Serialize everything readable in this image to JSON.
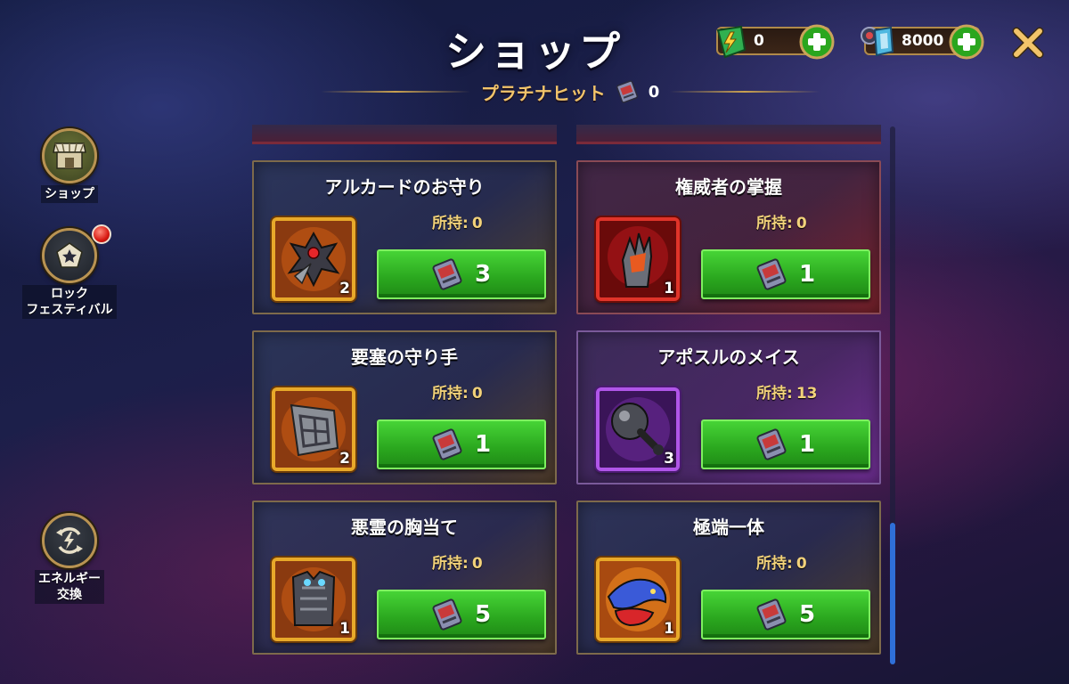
{
  "header": {
    "title": "ショップ",
    "subtitle": "プラチナヒット",
    "ticket_count": "0"
  },
  "currencies": {
    "energy": {
      "value": "0",
      "icon": "energy-gem-icon"
    },
    "gems": {
      "value": "8000",
      "icon": "crystal-gem-icon"
    }
  },
  "sidebar": {
    "items": [
      {
        "label": "ショップ",
        "icon": "shop-icon",
        "active": true
      },
      {
        "label": "ロック\nフェスティバル",
        "label_line1": "ロック",
        "label_line2": "フェスティバル",
        "icon": "star-pentagon-icon",
        "has_badge": true
      },
      {
        "label": "エネルギー\n交換",
        "label_line1": "エネルギー",
        "label_line2": "交換",
        "icon": "energy-exchange-icon"
      }
    ]
  },
  "owned_label": "所持:",
  "items": [
    {
      "name": "アルカードのお守り",
      "owned": "0",
      "tier": "2",
      "price": "3",
      "rarity": "gold"
    },
    {
      "name": "権威者の掌握",
      "owned": "0",
      "tier": "1",
      "price": "1",
      "rarity": "red"
    },
    {
      "name": "要塞の守り手",
      "owned": "0",
      "tier": "2",
      "price": "1",
      "rarity": "gold"
    },
    {
      "name": "アポスルのメイス",
      "owned": "13",
      "tier": "3",
      "price": "1",
      "rarity": "purple"
    },
    {
      "name": "悪霊の胸当て",
      "owned": "0",
      "tier": "1",
      "price": "5",
      "rarity": "gold"
    },
    {
      "name": "極端一体",
      "owned": "0",
      "tier": "1",
      "price": "5",
      "rarity": "gold"
    }
  ],
  "colors": {
    "accent_gold": "#f2c46a",
    "buy_green": "#2aa61e",
    "scroll_thumb": "#2f6fd8"
  }
}
